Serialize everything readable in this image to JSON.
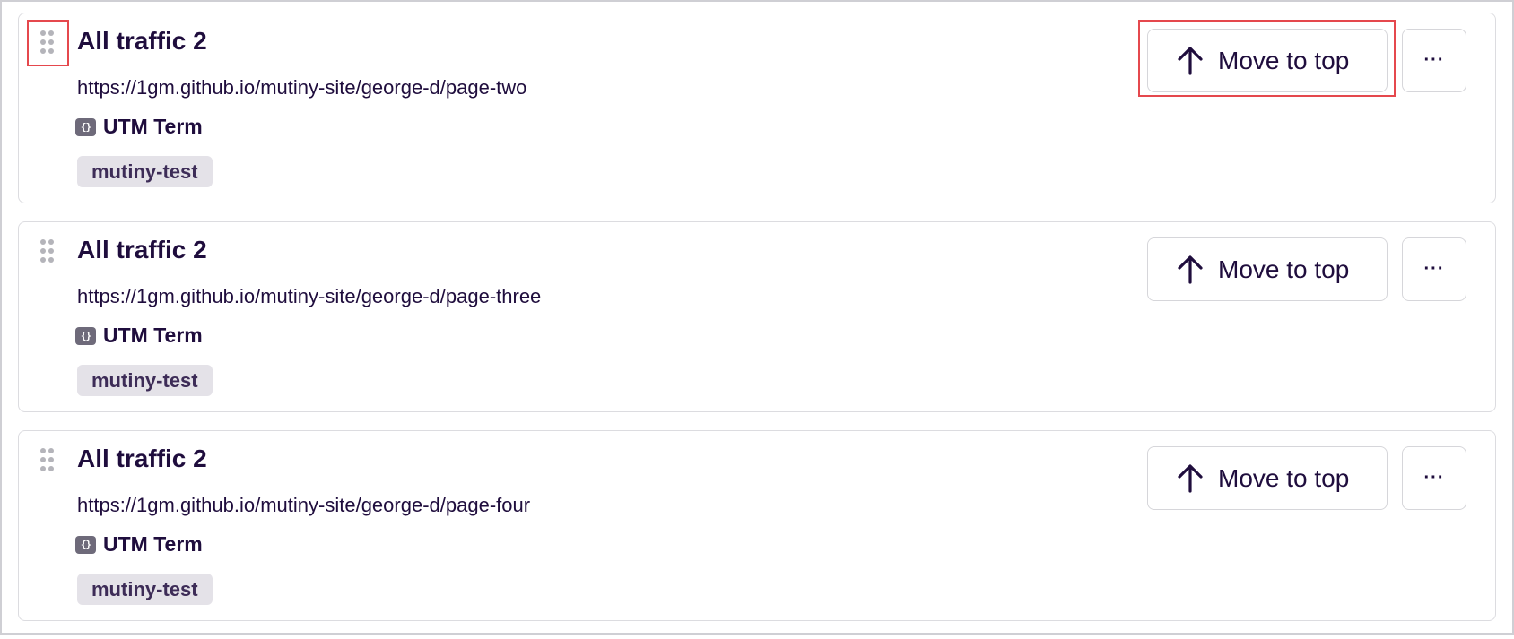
{
  "items": [
    {
      "title": "All traffic 2",
      "url": "https://1gm.github.io/mutiny-site/george-d/page-two",
      "condition_label": "UTM Term",
      "condition_icon": "code-brackets-icon",
      "tag": "mutiny-test",
      "move_label": "Move to top",
      "more_label": "···"
    },
    {
      "title": "All traffic 2",
      "url": "https://1gm.github.io/mutiny-site/george-d/page-three",
      "condition_label": "UTM Term",
      "condition_icon": "code-brackets-icon",
      "tag": "mutiny-test",
      "move_label": "Move to top",
      "more_label": "···"
    },
    {
      "title": "All traffic 2",
      "url": "https://1gm.github.io/mutiny-site/george-d/page-four",
      "condition_label": "UTM Term",
      "condition_icon": "code-brackets-icon",
      "tag": "mutiny-test",
      "move_label": "Move to top",
      "more_label": "···"
    }
  ],
  "utm_icon_glyph": "{}",
  "colors": {
    "text": "#1f0d3d",
    "border": "#dcdce0",
    "tag_bg": "#e4e2e8",
    "highlight": "#e5484d"
  }
}
